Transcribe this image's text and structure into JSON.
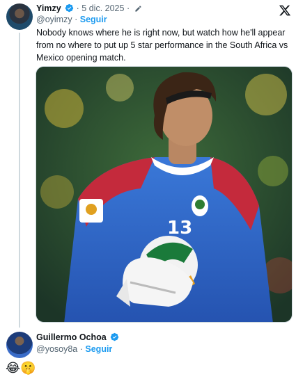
{
  "tweet": {
    "author_name": "Yimzy",
    "author_handle": "@oyimzy",
    "date": "5 dic. 2025",
    "separator": "·",
    "follow_label": "Seguir",
    "text": "Nobody knows where he is right now, but watch how he'll appear from no where to put up 5 star performance in the South Africa vs Mexico opening match.",
    "media": {
      "jersey_number": "13"
    }
  },
  "reply": {
    "author_name": "Guillermo Ochoa",
    "author_handle": "@yosoy8a",
    "separator": "·",
    "follow_label": "Seguir",
    "text": "😂🤫"
  },
  "icons": {
    "verified": "verified-badge-icon",
    "edit": "edit-pencil-icon",
    "brand": "x-logo-icon"
  },
  "colors": {
    "accent": "#1d9bf0",
    "text": "#0f1419",
    "muted": "#536471"
  }
}
